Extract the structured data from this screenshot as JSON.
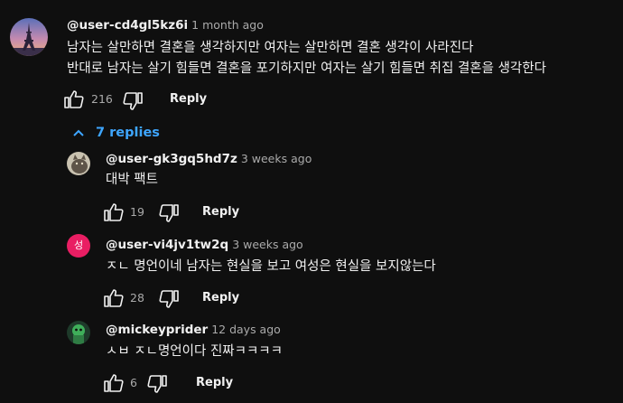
{
  "comments": [
    {
      "username": "@user-cd4gl5kz6i",
      "time": "1 month ago",
      "lines": [
        "남자는 살만하면 결혼을 생각하지만 여자는 살만하면 결혼 생각이 사라진다",
        "반대로 남자는 살기 힘들면 결혼을 포기하지만 여자는 살기 힘들면 취집 결혼을 생각한다"
      ],
      "likes": "216",
      "reply_label": "Reply",
      "avatar_icon": "eiffel-tower-avatar"
    }
  ],
  "replies_toggle": {
    "label": "7 replies",
    "icon": "chevron-up-icon"
  },
  "replies": [
    {
      "username": "@user-gk3gq5hd7z",
      "time": "3 weeks ago",
      "text": "대박 팩트",
      "likes": "19",
      "reply_label": "Reply",
      "avatar_icon": "cat-photo-avatar"
    },
    {
      "username": "@user-vi4jv1tw2q",
      "time": "3 weeks ago",
      "text": "ㅈㄴ 명언이네 남자는 현실을 보고 여성은 현실을 보지않는다",
      "likes": "28",
      "reply_label": "Reply",
      "avatar_letter": "성",
      "avatar_color": "#e91e63"
    },
    {
      "username": "@mickeyprider",
      "time": "12 days ago",
      "text": "ㅅㅂ ㅈㄴ명언이다 진짜ㅋㅋㅋㅋ",
      "likes": "6",
      "reply_label": "Reply",
      "avatar_icon": "green-character-avatar"
    }
  ],
  "colors": {
    "background": "#0f0f0f",
    "text": "#f1f1f1",
    "secondary": "#aaaaaa",
    "link": "#3ea6ff"
  }
}
